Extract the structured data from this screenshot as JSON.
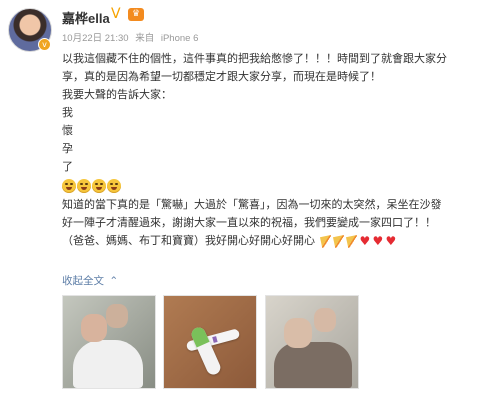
{
  "user": {
    "name": "嘉桦ella",
    "vip_icon": "verified-v-icon",
    "member_icon": "member-crown-icon",
    "date": "10月22日 21:30",
    "source_prefix": "来自",
    "source": "iPhone 6"
  },
  "post": {
    "lines": [
      "以我這個藏不住的個性，這件事真的把我給憋慘了！！！時間到了就會跟大家分",
      "享，真的是因為希望一切都穩定才跟大家分享，而現在是時候了！",
      "我要大聲的告訴大家：",
      "我",
      "懷",
      "孕",
      "了",
      "知道的當下真的是「驚嚇」大過於「驚喜」，因為一切來的太突然，呆坐在沙發",
      "好一陣子才清醒過來，謝謝大家一直以來的祝福，我們要變成一家四口了！！",
      "（爸爸、媽媽、布丁和寶寶）我好開心好開心好開心"
    ],
    "emoji_names": [
      "laughing-emoji",
      "laughing-emoji",
      "laughing-emoji",
      "laughing-emoji"
    ],
    "ending_icons": [
      "party-icon",
      "party-icon",
      "party-icon",
      "heart-icon",
      "heart-icon",
      "heart-icon"
    ]
  },
  "actions": {
    "collapse_label": "收起全文",
    "collapse_icon": "chevron-up-icon"
  },
  "photos": [
    {
      "label": "couple-photo"
    },
    {
      "label": "pregnancy-test-photo"
    },
    {
      "label": "family-photo"
    }
  ],
  "colors": {
    "link": "#5f7fa8",
    "meta": "#999999",
    "heart": "#e52b32",
    "vip": "#f6a300"
  }
}
